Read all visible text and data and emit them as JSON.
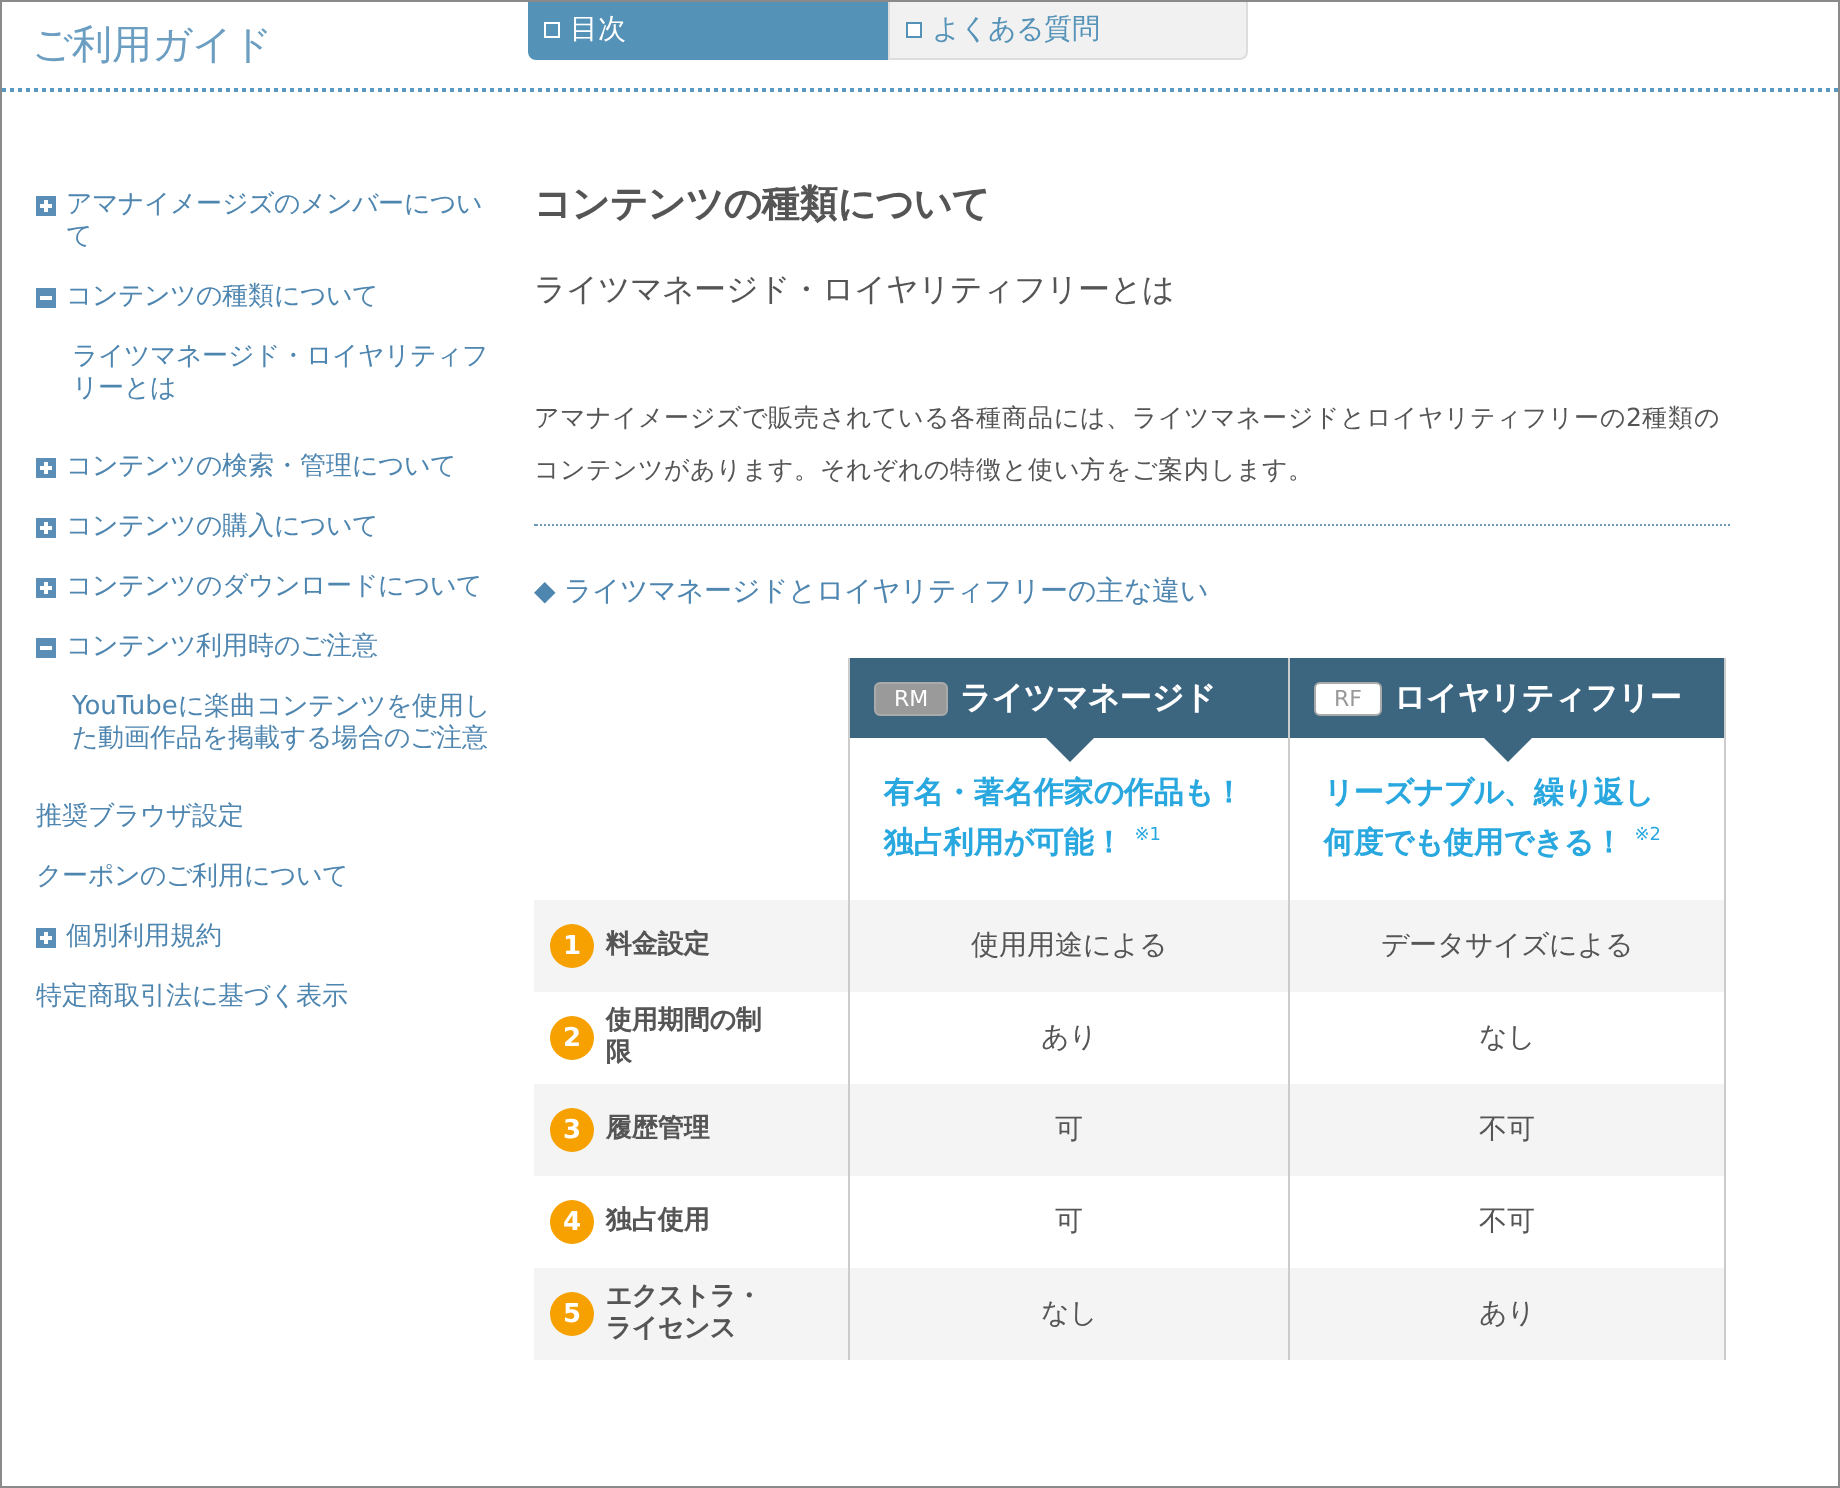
{
  "header": {
    "title": "ご利用ガイド"
  },
  "tabs": [
    {
      "label": "目次",
      "selected": true
    },
    {
      "label": "よくある質問",
      "selected": false
    }
  ],
  "sidebar": {
    "items": [
      {
        "label": "アマナイメージズのメンバーについて",
        "kind": "toggle",
        "expanded": false
      },
      {
        "label": "コンテンツの種類について",
        "kind": "toggle",
        "expanded": true,
        "children": [
          {
            "label": "ライツマネージド・ロイヤリティフリーとは"
          }
        ]
      },
      {
        "label": "コンテンツの検索・管理について",
        "kind": "toggle",
        "expanded": false
      },
      {
        "label": "コンテンツの購入について",
        "kind": "toggle",
        "expanded": false
      },
      {
        "label": "コンテンツのダウンロードについて",
        "kind": "toggle",
        "expanded": false
      },
      {
        "label": "コンテンツ利用時のご注意",
        "kind": "toggle",
        "expanded": true,
        "children": [
          {
            "label": "YouTubeに楽曲コンテンツを使用した動画作品を掲載する場合のご注意"
          }
        ]
      },
      {
        "label": "推奨ブラウザ設定",
        "kind": "link"
      },
      {
        "label": "クーポンのご利用について",
        "kind": "link"
      },
      {
        "label": "個別利用規約",
        "kind": "toggle",
        "expanded": false
      },
      {
        "label": "特定商取引法に基づく表示",
        "kind": "link"
      }
    ]
  },
  "main": {
    "heading": "コンテンツの種類について",
    "subheading": "ライツマネージド・ロイヤリティフリーとは",
    "paragraph": "アマナイメージズで販売されている各種商品には、ライツマネージドとロイヤリティフリーの2種類のコンテンツがあります。それぞれの特徴と使い方をご案内します。",
    "section_heading": "◆ ライツマネージドとロイヤリティフリーの主な違い",
    "comparison": {
      "columns": [
        {
          "badge": "RM",
          "kind": "filled",
          "name": "ライツマネージド",
          "tagline": [
            "有名・著名作家の作品も！",
            "独占利用が可能！ $^{※1}$"
          ]
        },
        {
          "badge": "RF",
          "kind": "outline",
          "name": "ロイヤリティフリー",
          "tagline": [
            "リーズナブル、繰り返し",
            "何度でも使用できる！ $^{※2}$"
          ]
        }
      ],
      "rows": [
        {
          "number": "1",
          "label": "料金設定",
          "values": [
            "使用用途による",
            "データサイズによる"
          ]
        },
        {
          "number": "2",
          "label": "使用期間の制限",
          "values": [
            "あり",
            "なし"
          ]
        },
        {
          "number": "3",
          "label": "履歴管理",
          "values": [
            "可",
            "不可"
          ]
        },
        {
          "number": "4",
          "label": "独占使用",
          "values": [
            "可",
            "不可"
          ]
        },
        {
          "number": "5",
          "label": "エクストラ・ライセンス",
          "values": [
            "なし",
            "あり"
          ]
        }
      ]
    }
  }
}
